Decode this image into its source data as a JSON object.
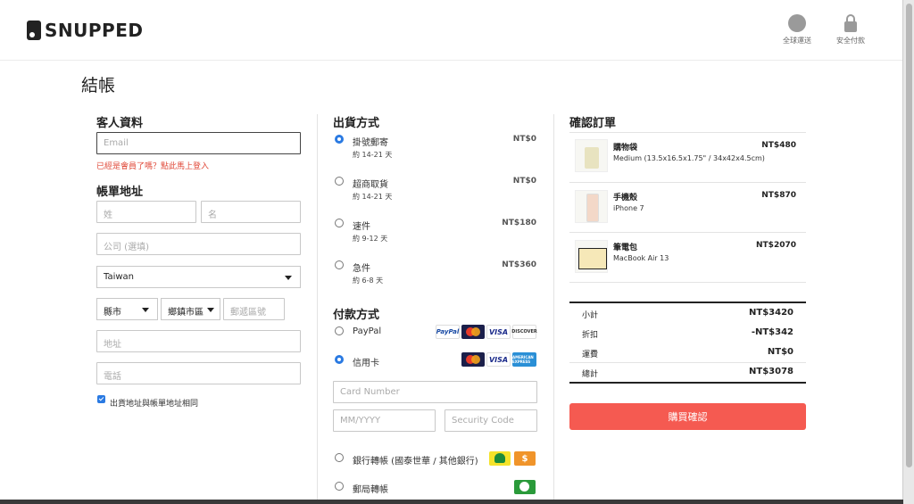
{
  "header": {
    "brand": "SNUPPED",
    "global_shipping": "全球運送",
    "secure_payment": "安全付款"
  },
  "page_title": "結帳",
  "customer": {
    "title": "客人資料",
    "email_placeholder": "Email",
    "member_hint": "已經是會員了嗎？點此馬上登入"
  },
  "billing": {
    "title": "帳單地址",
    "last_name_placeholder": "姓",
    "first_name_placeholder": "名",
    "company_placeholder": "公司 (選填)",
    "country_value": "Taiwan",
    "city_value": "縣市",
    "district_value": "鄉鎮市區",
    "zip_placeholder": "郵遞區號",
    "address_placeholder": "地址",
    "phone_placeholder": "電話",
    "same_address_label": "出貨地址與帳單地址相同"
  },
  "shipping": {
    "title": "出貨方式",
    "options": [
      {
        "name": "掛號郵寄",
        "days": "約 14-21 天",
        "price": "NT$0",
        "selected": true
      },
      {
        "name": "超商取貨",
        "days": "約 14-21 天",
        "price": "NT$0",
        "selected": false
      },
      {
        "name": "速件",
        "days": "約 9-12 天",
        "price": "NT$180",
        "selected": false
      },
      {
        "name": "急件",
        "days": "約 6-8 天",
        "price": "NT$360",
        "selected": false
      }
    ]
  },
  "payment": {
    "title": "付款方式",
    "paypal": "PayPal",
    "credit_card": "信用卡",
    "card_number_placeholder": "Card Number",
    "expiry_placeholder": "MM/YYYY",
    "security_placeholder": "Security Code",
    "bank_transfer": "銀行轉帳 (國泰世華 / 其他銀行)",
    "post_transfer": "郵局轉帳",
    "logo_paypal": "PayPal",
    "logo_visa": "VISA",
    "logo_discover": "DISCOVER",
    "logo_amex": "AMERICAN EXPRESS",
    "logo_dollar": "$"
  },
  "order": {
    "title": "確認訂單",
    "items": [
      {
        "name": "購物袋",
        "desc": "Medium (13.5x16.5x1.75\" / 34x42x4.5cm)",
        "price": "NT$480"
      },
      {
        "name": "手機殼",
        "desc": "iPhone 7",
        "price": "NT$870"
      },
      {
        "name": "筆電包",
        "desc": "MacBook Air 13",
        "price": "NT$2070"
      }
    ],
    "subtotal_label": "小計",
    "subtotal": "NT$3420",
    "discount_label": "折扣",
    "discount": "-NT$342",
    "shipping_label": "運費",
    "shipping": "NT$0",
    "total_label": "總計",
    "total": "NT$3078",
    "confirm_button": "購買確認"
  },
  "colors": {
    "accent": "#f55a51",
    "radio": "#2a7ae2",
    "warning": "#e04a3a"
  }
}
